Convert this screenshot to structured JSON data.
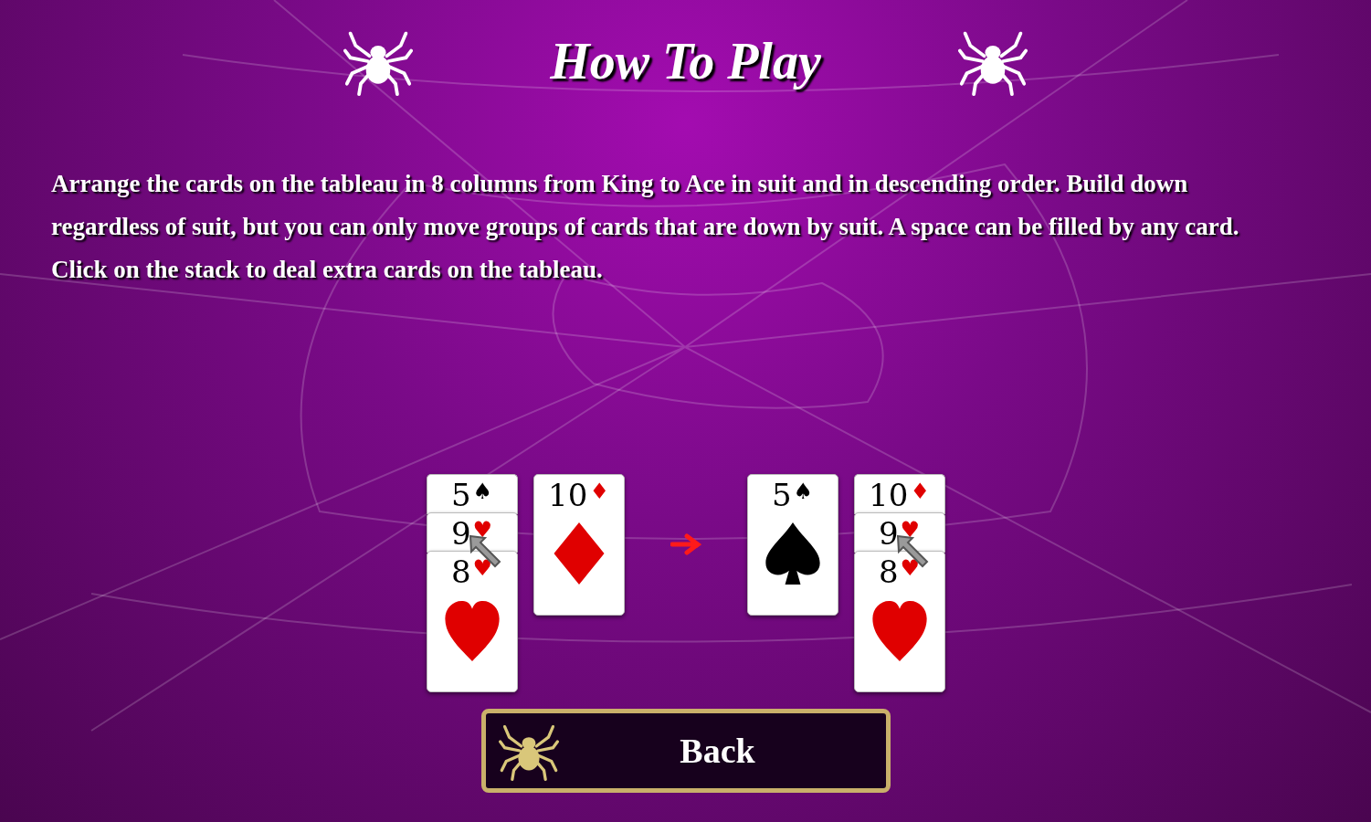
{
  "title": "How To Play",
  "instructions": "Arrange the cards on the tableau in 8 columns from King to Ace in suit and in descending order. Build down regardless of suit, but you can only move groups of cards that are down by suit. A space can be filled by any card. Click on the stack to deal extra cards on the tableau.",
  "example": {
    "before": [
      {
        "pointer": true,
        "cards": [
          {
            "rank": "5",
            "suit": "♠",
            "kind": "spades"
          },
          {
            "rank": "9",
            "suit": "♥",
            "kind": "hearts"
          },
          {
            "rank": "8",
            "suit": "♥",
            "kind": "hearts"
          }
        ]
      },
      {
        "pointer": false,
        "cards": [
          {
            "rank": "10",
            "suit": "♦",
            "kind": "diamonds"
          }
        ]
      }
    ],
    "after": [
      {
        "pointer": false,
        "cards": [
          {
            "rank": "5",
            "suit": "♠",
            "kind": "spades"
          }
        ]
      },
      {
        "pointer": true,
        "cards": [
          {
            "rank": "10",
            "suit": "♦",
            "kind": "diamonds"
          },
          {
            "rank": "9",
            "suit": "♥",
            "kind": "hearts"
          },
          {
            "rank": "8",
            "suit": "♥",
            "kind": "hearts"
          }
        ]
      }
    ]
  },
  "back_button": {
    "label": "Back"
  }
}
